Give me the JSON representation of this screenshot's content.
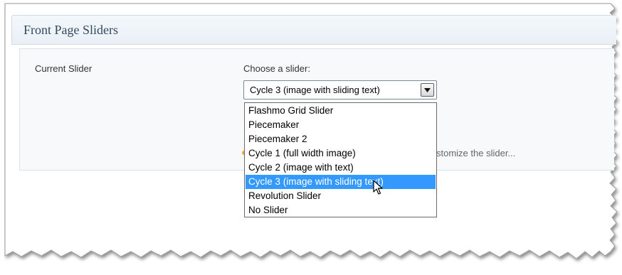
{
  "header": {
    "title": "Front Page Sliders"
  },
  "form": {
    "current_slider_label": "Current Slider",
    "choose_label": "Choose a slider:",
    "selected_value": "Cycle 3 (image with sliding text)",
    "customize_text": "stomize the slider..."
  },
  "dropdown": {
    "options": [
      "Flashmo Grid Slider",
      "Piecemaker",
      "Piecemaker 2",
      "Cycle 1 (full width image)",
      "Cycle 2 (image with text)",
      "Cycle 3 (image with sliding text)",
      "Revolution Slider",
      "No Slider"
    ],
    "highlighted_index": 5,
    "highlight_color": "#3399ff"
  },
  "icons": {
    "select_arrow": "chevron-down-icon",
    "cursor": "mouse-pointer-icon"
  }
}
